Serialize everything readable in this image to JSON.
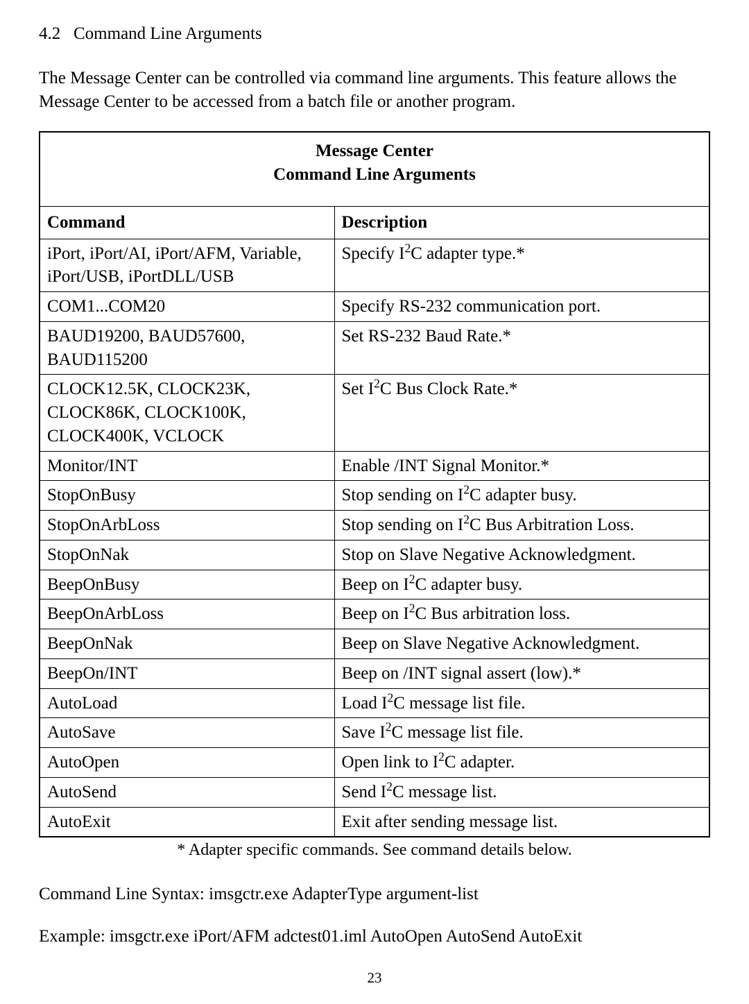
{
  "section_number": "4.2",
  "section_title": "Command Line Arguments",
  "intro_text": "The Message Center can be controlled via command line arguments. This feature allows the Message Center to be accessed from a batch file or another program.",
  "table": {
    "title_line1": "Message Center",
    "title_line2": "Command Line Arguments",
    "header_col1": "Command",
    "header_col2": "Description",
    "rows": [
      {
        "cmd": "iPort, iPort/AI, iPort/AFM, Variable, iPort/USB, iPortDLL/USB",
        "desc_pre": "Specify ",
        "i2c": true,
        "desc_post": " adapter type.*"
      },
      {
        "cmd": "COM1...COM20",
        "desc_pre": "Specify RS-232 communication port.",
        "i2c": false,
        "desc_post": ""
      },
      {
        "cmd": "BAUD19200, BAUD57600, BAUD115200",
        "desc_pre": "Set RS-232 Baud Rate.*",
        "i2c": false,
        "desc_post": ""
      },
      {
        "cmd": "CLOCK12.5K, CLOCK23K, CLOCK86K, CLOCK100K, CLOCK400K, VCLOCK",
        "desc_pre": "Set ",
        "i2c": true,
        "desc_post": " Bus Clock Rate.*"
      },
      {
        "cmd": "Monitor/INT",
        "desc_pre": "Enable /INT Signal Monitor.*",
        "i2c": false,
        "desc_post": ""
      },
      {
        "cmd": "StopOnBusy",
        "desc_pre": "Stop sending on ",
        "i2c": true,
        "desc_post": " adapter busy."
      },
      {
        "cmd": "StopOnArbLoss",
        "desc_pre": "Stop sending on ",
        "i2c": true,
        "desc_post": " Bus Arbitration Loss."
      },
      {
        "cmd": "StopOnNak",
        "desc_pre": "Stop on Slave Negative Acknowledgment.",
        "i2c": false,
        "desc_post": ""
      },
      {
        "cmd": "BeepOnBusy",
        "desc_pre": "Beep on ",
        "i2c": true,
        "desc_post": " adapter busy."
      },
      {
        "cmd": "BeepOnArbLoss",
        "desc_pre": "Beep on ",
        "i2c": true,
        "desc_post": " Bus arbitration loss."
      },
      {
        "cmd": "BeepOnNak",
        "desc_pre": "Beep on Slave Negative Acknowledgment.",
        "i2c": false,
        "desc_post": ""
      },
      {
        "cmd": "BeepOn/INT",
        "desc_pre": "Beep on /INT signal assert (low).*",
        "i2c": false,
        "desc_post": ""
      },
      {
        "cmd": "AutoLoad",
        "desc_pre": "Load ",
        "i2c": true,
        "desc_post": " message list file."
      },
      {
        "cmd": "AutoSave",
        "desc_pre": "Save ",
        "i2c": true,
        "desc_post": " message list file."
      },
      {
        "cmd": "AutoOpen",
        "desc_pre": "Open link to ",
        "i2c": true,
        "desc_post": " adapter."
      },
      {
        "cmd": "AutoSend",
        "desc_pre": "Send ",
        "i2c": true,
        "desc_post": " message list."
      },
      {
        "cmd": "AutoExit",
        "desc_pre": "Exit after sending message list.",
        "i2c": false,
        "desc_post": ""
      }
    ]
  },
  "footnote": "* Adapter specific commands. See command details below.",
  "syntax_line": "Command Line Syntax: imsgctr.exe AdapterType argument-list",
  "example_line": "Example: imsgctr.exe iPort/AFM adctest01.iml AutoOpen AutoSend AutoExit",
  "page_number": "23"
}
